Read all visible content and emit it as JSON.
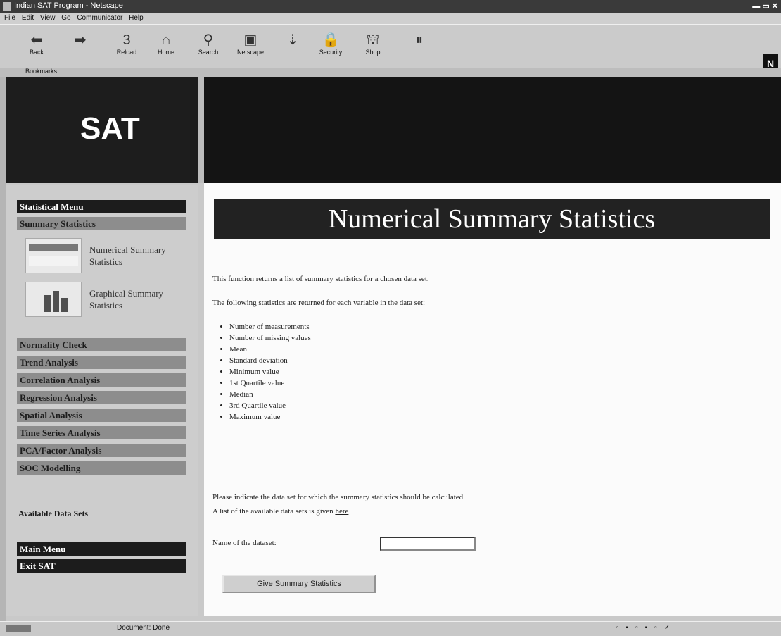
{
  "window": {
    "title": "Indian SAT Program - Netscape"
  },
  "menu": [
    "File",
    "Edit",
    "View",
    "Go",
    "Communicator",
    "Help"
  ],
  "toolbar": {
    "buttons": [
      {
        "label": "Back",
        "icon": "back-arrow-icon",
        "glyph": "⬅"
      },
      {
        "label": "",
        "icon": "forward-arrow-icon",
        "glyph": "➡"
      },
      {
        "label": "Reload",
        "icon": "reload-icon",
        "glyph": "3"
      },
      {
        "label": "Home",
        "icon": "home-icon",
        "glyph": "⌂"
      },
      {
        "label": "Search",
        "icon": "search-icon",
        "glyph": "⚲"
      },
      {
        "label": "Netscape",
        "icon": "netscape-icon",
        "glyph": "▣"
      },
      {
        "label": "",
        "icon": "print-icon",
        "glyph": "⇣"
      },
      {
        "label": "Security",
        "icon": "security-icon",
        "glyph": "🔒"
      },
      {
        "label": "Shop",
        "icon": "shop-icon",
        "glyph": "⛫"
      },
      {
        "label": "",
        "icon": "stop-icon",
        "glyph": "⏸"
      }
    ],
    "logo": "N"
  },
  "location_bar": {
    "label": "Bookmarks"
  },
  "banner": {
    "text": "SAT"
  },
  "sidebar": {
    "statistical_menu": "Statistical Menu",
    "summary_statistics": "Summary Statistics",
    "subitems": [
      {
        "label": "Numerical Summary Statistics"
      },
      {
        "label": "Graphical Summary Statistics"
      }
    ],
    "sections": [
      "Normality Check",
      "Trend Analysis",
      "Correlation Analysis",
      "Regression Analysis",
      "Spatial Analysis",
      "Time Series Analysis",
      "PCA/Factor Analysis",
      "SOC Modelling"
    ],
    "available_data_sets": "Available Data Sets",
    "main_menu": "Main Menu",
    "exit": "Exit SAT"
  },
  "content": {
    "heading": "Numerical Summary Statistics",
    "intro1": "This function returns a list of summary statistics for a chosen data set.",
    "intro2": "The following statistics are returned for each variable in the data set:",
    "stats": [
      "Number of measurements",
      "Number of missing values",
      "Mean",
      "Standard deviation",
      "Minimum value",
      "1st Quartile value",
      "Median",
      "3rd Quartile value",
      "Maximum value"
    ],
    "instruction1": "Please indicate the data set for which the summary statistics should be calculated.",
    "instruction2_prefix": "A list of the available data sets is given ",
    "here_link": "here",
    "dataset_label": "Name of the dataset:",
    "dataset_value": "",
    "button": "Give Summary Statistics"
  },
  "status": {
    "text": "Document: Done"
  },
  "colors": {
    "banner": "#141414",
    "menu_dark": "#1c1c1c",
    "menu_gray": "#8d8d8d"
  }
}
